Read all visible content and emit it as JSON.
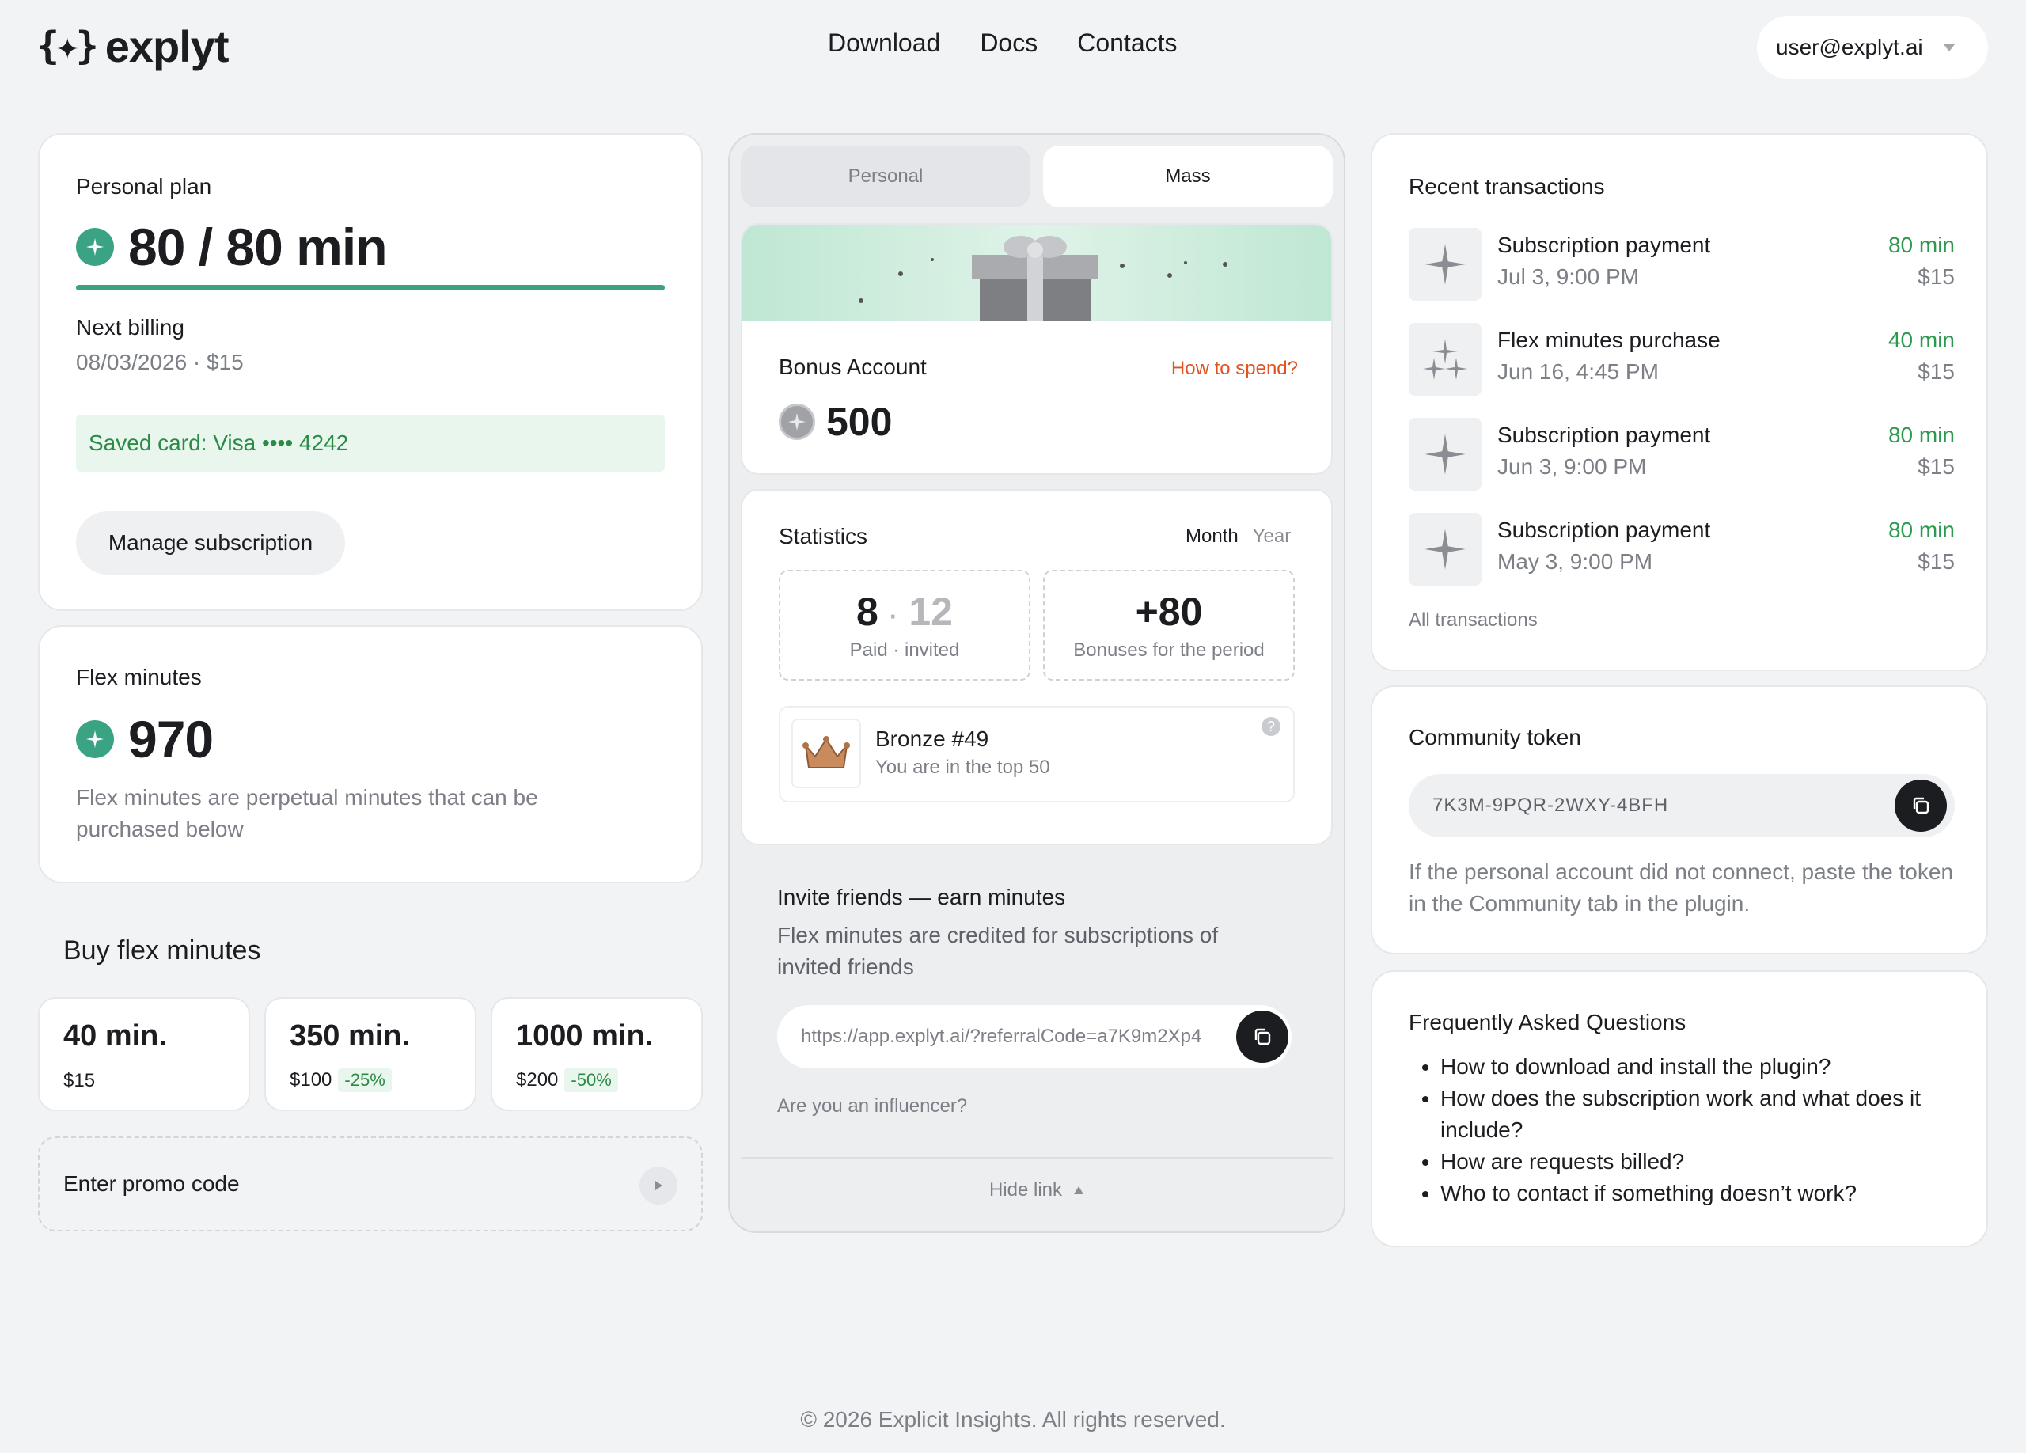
{
  "header": {
    "logo_mark": "{✦}",
    "logo_text": "explyt",
    "nav": [
      "Download",
      "Docs",
      "Contacts"
    ],
    "user_email": "user@explyt.ai"
  },
  "personal_plan": {
    "title": "Personal plan",
    "minutes": "80 / 80 min",
    "minutes_used_fraction": 1.0,
    "next_billing_label": "Next billing",
    "next_billing_value": "08/03/2026 · $15",
    "saved_card": "Saved card: Visa •••• 4242",
    "manage_button": "Manage subscription"
  },
  "flex_minutes": {
    "title": "Flex minutes",
    "value": "970",
    "description": "Flex minutes are perpetual minutes that can be purchased below"
  },
  "buy_flex": {
    "title": "Buy flex minutes",
    "options": [
      {
        "minutes": "40 min.",
        "price": "$15",
        "discount": ""
      },
      {
        "minutes": "350 min.",
        "price": "$100",
        "discount": "-25%"
      },
      {
        "minutes": "1000 min.",
        "price": "$200",
        "discount": "-50%"
      }
    ],
    "promo_placeholder": "Enter promo code"
  },
  "center": {
    "tabs": [
      "Personal",
      "Mass"
    ],
    "active_tab": "Mass",
    "bonus": {
      "title": "Bonus Account",
      "how_to_spend": "How to spend?",
      "value": "500"
    },
    "statistics": {
      "title": "Statistics",
      "periods": [
        "Month",
        "Year"
      ],
      "active_period": "Month",
      "paid": "8",
      "separator": "·",
      "invited": "12",
      "paid_invited_label": "Paid · invited",
      "bonuses": "+80",
      "bonuses_label": "Bonuses for the period",
      "rank_title": "Bronze #49",
      "rank_subtitle": "You are in the top 50",
      "help_glyph": "?"
    },
    "invite": {
      "title": "Invite friends — earn minutes",
      "description": "Flex minutes are credited for subscriptions of invited friends",
      "link": "https://app.explyt.ai/?referralCode=a7K9m2Xp4",
      "influencer": "Are you an influencer?",
      "hide_link": "Hide link"
    }
  },
  "transactions": {
    "title": "Recent transactions",
    "items": [
      {
        "title": "Subscription payment",
        "date": "Jul 3, 9:00 PM",
        "minutes": "80 min",
        "amount": "$15",
        "icon": "sparkle-icon"
      },
      {
        "title": "Flex minutes purchase",
        "date": "Jun 16, 4:45 PM",
        "minutes": "40 min",
        "amount": "$15",
        "icon": "sparkles-icon"
      },
      {
        "title": "Subscription payment",
        "date": "Jun 3, 9:00 PM",
        "minutes": "80 min",
        "amount": "$15",
        "icon": "sparkle-icon"
      },
      {
        "title": "Subscription payment",
        "date": "May 3, 9:00 PM",
        "minutes": "80 min",
        "amount": "$15",
        "icon": "sparkle-icon"
      }
    ],
    "all_link": "All transactions"
  },
  "community": {
    "title": "Community token",
    "token": "7K3M-9PQR-2WXY-4BFH",
    "description": "If the personal account did not connect, paste the token in the Community tab in the plugin."
  },
  "faq": {
    "title": "Frequently Asked Questions",
    "items": [
      "How to download and install the plugin?",
      "How does the subscription work and what does it include?",
      "How are requests billed?",
      "Who to contact if something doesn’t work?"
    ]
  },
  "footer": "© 2026 Explicit Insights. All rights reserved.",
  "colors": {
    "accent_green": "#3aa384",
    "positive": "#2b9a4e",
    "warning_link": "#e0521f",
    "background": "#f2f3f5"
  }
}
